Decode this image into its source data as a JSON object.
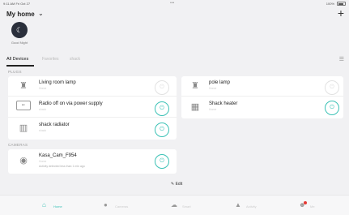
{
  "status": {
    "time": "9:11 AM  Fri Oct 27",
    "battery": "100%",
    "dots": "•••"
  },
  "header": {
    "title": "My home",
    "add_label": "+"
  },
  "scene": {
    "label": "Good Night",
    "icon": "moon-icon"
  },
  "tabs": [
    {
      "label": "All Devices",
      "active": true
    },
    {
      "label": "Favorites",
      "active": false
    },
    {
      "label": "shack",
      "active": false
    }
  ],
  "sections": {
    "plugs": "PLUGS",
    "cameras": "CAMERAS"
  },
  "plugs": [
    {
      "name": "Living room lamp",
      "room": "Home",
      "on": false,
      "icon": "lamp-icon"
    },
    {
      "name": "pole lamp",
      "room": "Home",
      "on": false,
      "icon": "lamp-icon"
    },
    {
      "name": "Radio off on via power supply",
      "room": "shack",
      "on": true,
      "icon": "plug-icon"
    },
    {
      "name": "Shack heater",
      "room": "Home",
      "on": true,
      "icon": "heater-icon"
    },
    {
      "name": "shack radiator",
      "room": "shack",
      "on": true,
      "icon": "radiator-icon"
    }
  ],
  "camera": {
    "name": "Kasa_Cam_F954",
    "room": "Home",
    "activity": "Activity detected less than 1 min ago",
    "on": true,
    "icon": "camera-icon"
  },
  "edit_label": "Edit",
  "tabbar": [
    {
      "label": "Home",
      "icon": "home-icon",
      "active": true
    },
    {
      "label": "Cameras",
      "icon": "camera-icon",
      "active": false
    },
    {
      "label": "Smart",
      "icon": "cloud-icon",
      "active": false
    },
    {
      "label": "Activity",
      "icon": "bell-icon",
      "active": false
    },
    {
      "label": "Me",
      "icon": "user-icon",
      "active": false
    }
  ],
  "colors": {
    "accent": "#3cc2b6",
    "off_ring": "#e2e2e2"
  }
}
